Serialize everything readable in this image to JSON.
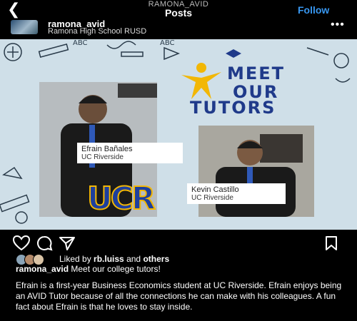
{
  "topbar": {
    "username_small": "RAMONA_AVID",
    "title": "Posts",
    "follow_label": "Follow",
    "back_icon": "chevron-left-icon"
  },
  "account": {
    "name": "ramona_avid",
    "location": "Ramona High School RUSD",
    "more_icon": "more-horizontal-icon"
  },
  "post": {
    "headline_lines": [
      "MEET",
      "OUR",
      "TUTORS"
    ],
    "tutor1": {
      "name": "Efrain Bañales",
      "school": "UC Riverside"
    },
    "tutor2": {
      "name": "Kevin Castillo",
      "school": "UC Riverside"
    },
    "logo": "UCR",
    "colors": {
      "background": "#cfdfe8",
      "headline": "#1f3a8a",
      "logo_blue": "#1d3f9e",
      "logo_gold": "#f2b705"
    }
  },
  "actions": {
    "like_icon": "heart-icon",
    "comment_icon": "comment-icon",
    "share_icon": "send-icon",
    "save_icon": "bookmark-icon"
  },
  "likes": {
    "prefix": "Liked by",
    "user": "rb.luiss",
    "joiner": "and",
    "suffix": "others"
  },
  "caption": {
    "username": "ramona_avid",
    "text": "Meet our college tutors!"
  },
  "description": "Efrain is a first-year Business Economics student at UC Riverside. Efrain enjoys being an AVID Tutor because of all the connections he can make with his colleagues. A fun fact about Efrain is that he loves to stay inside."
}
